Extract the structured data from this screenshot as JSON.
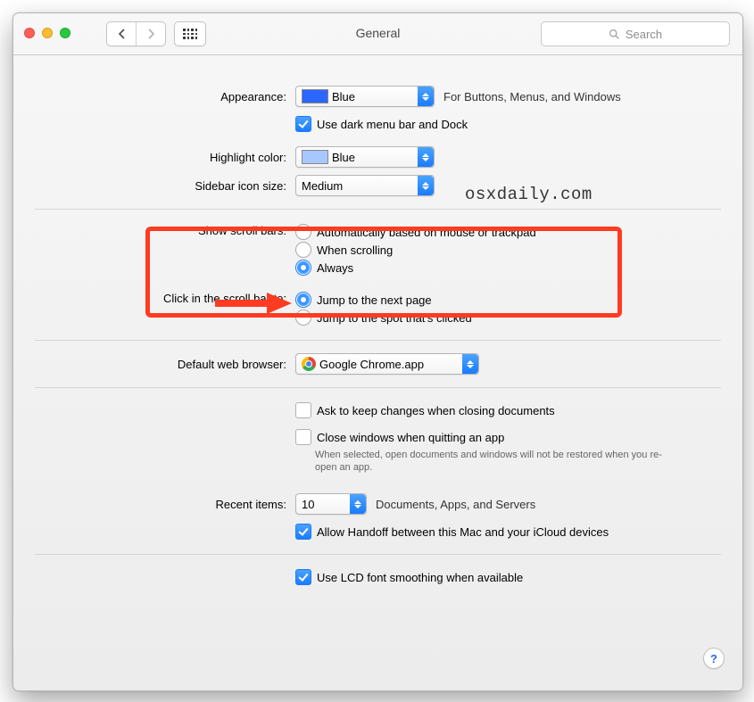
{
  "window": {
    "title": "General"
  },
  "search": {
    "placeholder": "Search"
  },
  "appearance": {
    "label": "Appearance:",
    "value": "Blue",
    "hint": "For Buttons, Menus, and Windows",
    "dark_menu_label": "Use dark menu bar and Dock",
    "dark_menu_checked": true
  },
  "highlight": {
    "label": "Highlight color:",
    "value": "Blue"
  },
  "sidebar_size": {
    "label": "Sidebar icon size:",
    "value": "Medium"
  },
  "scrollbars": {
    "label": "Show scroll bars:",
    "options": [
      "Automatically based on mouse or trackpad",
      "When scrolling",
      "Always"
    ],
    "selected": 2
  },
  "click_scrollbar": {
    "label": "Click in the scroll bar to:",
    "options": [
      "Jump to the next page",
      "Jump to the spot that's clicked"
    ],
    "selected": 0
  },
  "default_browser": {
    "label": "Default web browser:",
    "value": "Google Chrome.app"
  },
  "documents": {
    "ask_keep_label": "Ask to keep changes when closing documents",
    "ask_keep_checked": false,
    "close_windows_label": "Close windows when quitting an app",
    "close_windows_checked": false,
    "close_windows_hint": "When selected, open documents and windows will not be restored when you re-open an app."
  },
  "recent": {
    "label": "Recent items:",
    "value": "10",
    "hint": "Documents, Apps, and Servers",
    "handoff_label": "Allow Handoff between this Mac and your iCloud devices",
    "handoff_checked": true
  },
  "lcd": {
    "label": "Use LCD font smoothing when available",
    "checked": true
  },
  "watermark": "osxdaily.com",
  "help_label": "?"
}
